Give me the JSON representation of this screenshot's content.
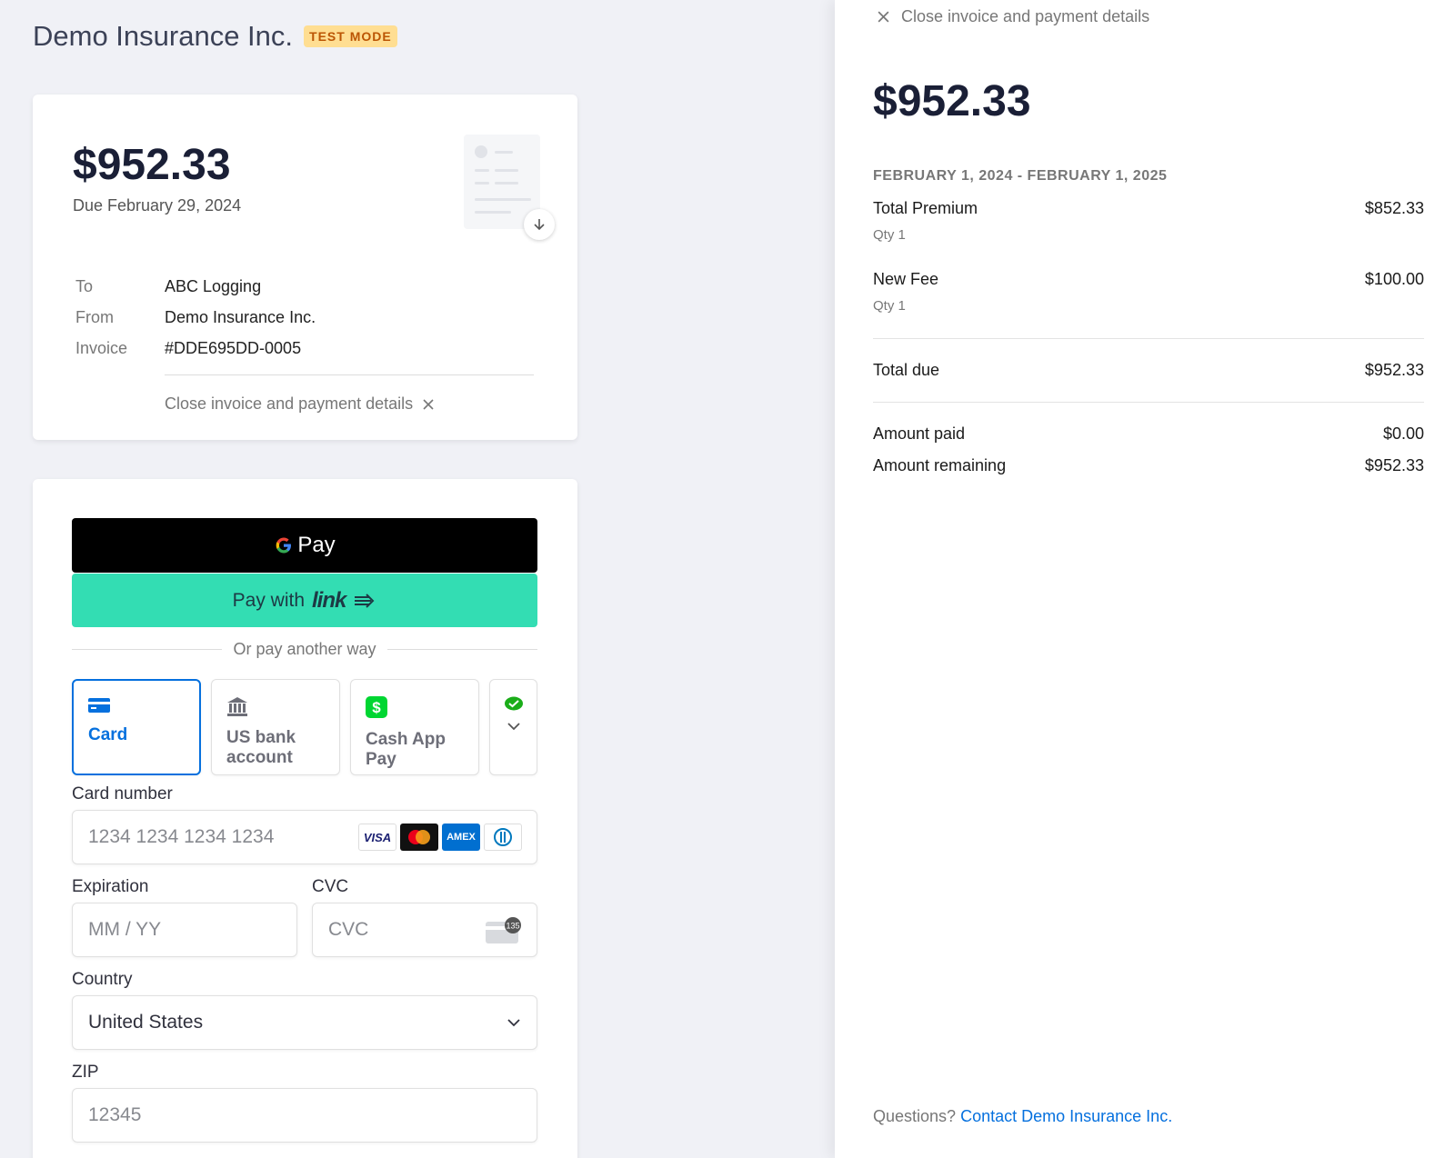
{
  "brand": {
    "name": "Demo Insurance Inc.",
    "badge": "TEST MODE"
  },
  "summary": {
    "amount": "$952.33",
    "due": "Due February 29, 2024",
    "meta": [
      {
        "key": "To",
        "value": "ABC Logging"
      },
      {
        "key": "From",
        "value": "Demo Insurance Inc."
      },
      {
        "key": "Invoice",
        "value": "#DDE695DD-0005"
      }
    ],
    "close_label": "Close invoice and payment details"
  },
  "payment": {
    "gpay_label": "Pay",
    "link_prefix": "Pay with",
    "link_brand": "link",
    "or_text": "Or pay another way",
    "tabs": [
      {
        "label": "Card",
        "icon": "card-icon",
        "active": true
      },
      {
        "label": "US bank account",
        "icon": "bank-icon",
        "active": false
      },
      {
        "label": "Cash App Pay",
        "icon": "cash-app-icon",
        "active": false
      }
    ],
    "card_number_label": "Card number",
    "card_number_placeholder": "1234 1234 1234 1234",
    "card_brands": [
      "VISA",
      "Mastercard",
      "AMEX",
      "Diners"
    ],
    "expiration_label": "Expiration",
    "expiration_placeholder": "MM / YY",
    "cvc_label": "CVC",
    "cvc_placeholder": "CVC",
    "cvc_badge": "135",
    "country_label": "Country",
    "country_value": "United States",
    "zip_label": "ZIP",
    "zip_placeholder": "12345"
  },
  "details": {
    "close_label": "Close invoice and payment details",
    "amount": "$952.33",
    "period": "FEBRUARY 1, 2024 - FEBRUARY 1, 2025",
    "items": [
      {
        "name": "Total Premium",
        "qty": "Qty 1",
        "price": "$852.33"
      },
      {
        "name": "New Fee",
        "qty": "Qty 1",
        "price": "$100.00"
      }
    ],
    "total_due_label": "Total due",
    "total_due": "$952.33",
    "amount_paid_label": "Amount paid",
    "amount_paid": "$0.00",
    "amount_remaining_label": "Amount remaining",
    "amount_remaining": "$952.33",
    "questions": "Questions?",
    "contact_link": "Contact Demo Insurance Inc."
  },
  "colors": {
    "accent": "#0570de",
    "link_green": "#33ddb3",
    "badge_bg": "#ffde92"
  }
}
